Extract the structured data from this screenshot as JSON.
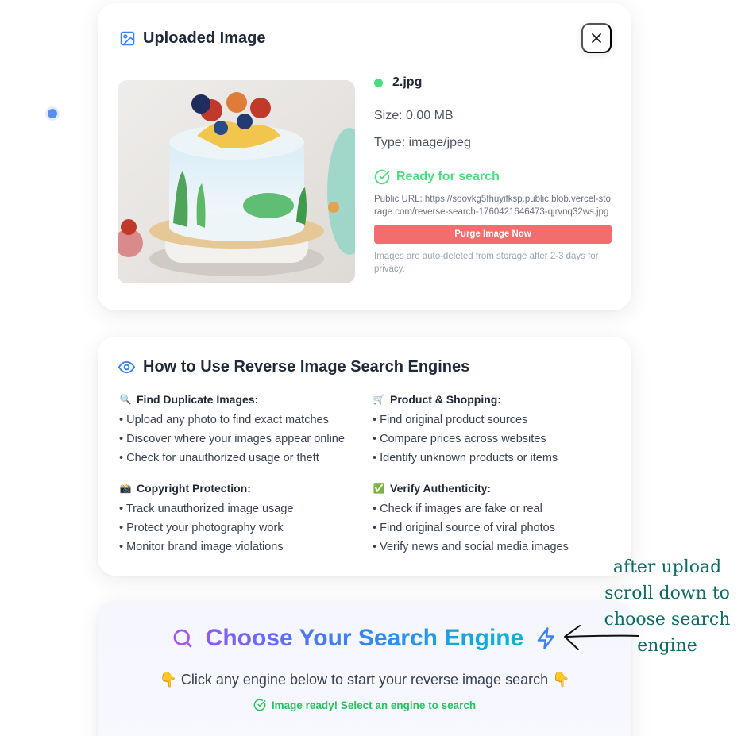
{
  "upload_card": {
    "title": "Uploaded Image",
    "icon": "image-icon",
    "file_name": "2.jpg",
    "size": "Size: 0.00 MB",
    "type": "Type: image/jpeg",
    "status": "Ready for search",
    "public_url": "Public URL: https://soovkg5fhuyifksp.public.blob.vercel-storage.com/reverse-search-1760421646473-qjrvnq32ws.jpg",
    "purge_label": "Purge Image Now",
    "note": "Images are auto-deleted from storage after 2-3 days for privacy.",
    "colors": {
      "status": "#4ade80",
      "purge": "#f26d6d"
    }
  },
  "how_card": {
    "title": "How to Use Reverse Image Search Engines",
    "icon": "eye-icon",
    "sections": [
      {
        "emoji": "🔍",
        "title": "Find Duplicate Images:",
        "items": [
          "• Upload any photo to find exact matches",
          "• Discover where your images appear online",
          "• Check for unauthorized usage or theft"
        ]
      },
      {
        "emoji": "🛒",
        "title": "Product & Shopping:",
        "items": [
          "• Find original product sources",
          "• Compare prices across websites",
          "• Identify unknown products or items"
        ]
      },
      {
        "emoji": "📸",
        "title": "Copyright Protection:",
        "items": [
          "• Track unauthorized image usage",
          "• Protect your photography work",
          "• Monitor brand image violations"
        ]
      },
      {
        "emoji": "✅",
        "title": "Verify Authenticity:",
        "items": [
          "• Check if images are fake or real",
          "• Find original source of viral photos",
          "• Verify news and social media images"
        ]
      }
    ]
  },
  "choose_card": {
    "title": "Choose Your Search Engine",
    "subtitle": "👇 Click any engine below to start your reverse image search 👇",
    "ready": "Image ready! Select an engine to search",
    "colors": {
      "gradient_start": "#8b5cf6",
      "gradient_mid": "#3b82f6",
      "gradient_end": "#06b6d4"
    }
  },
  "annotation": {
    "text": "after upload scroll down to choose search engine",
    "color": "#0f6b63"
  }
}
